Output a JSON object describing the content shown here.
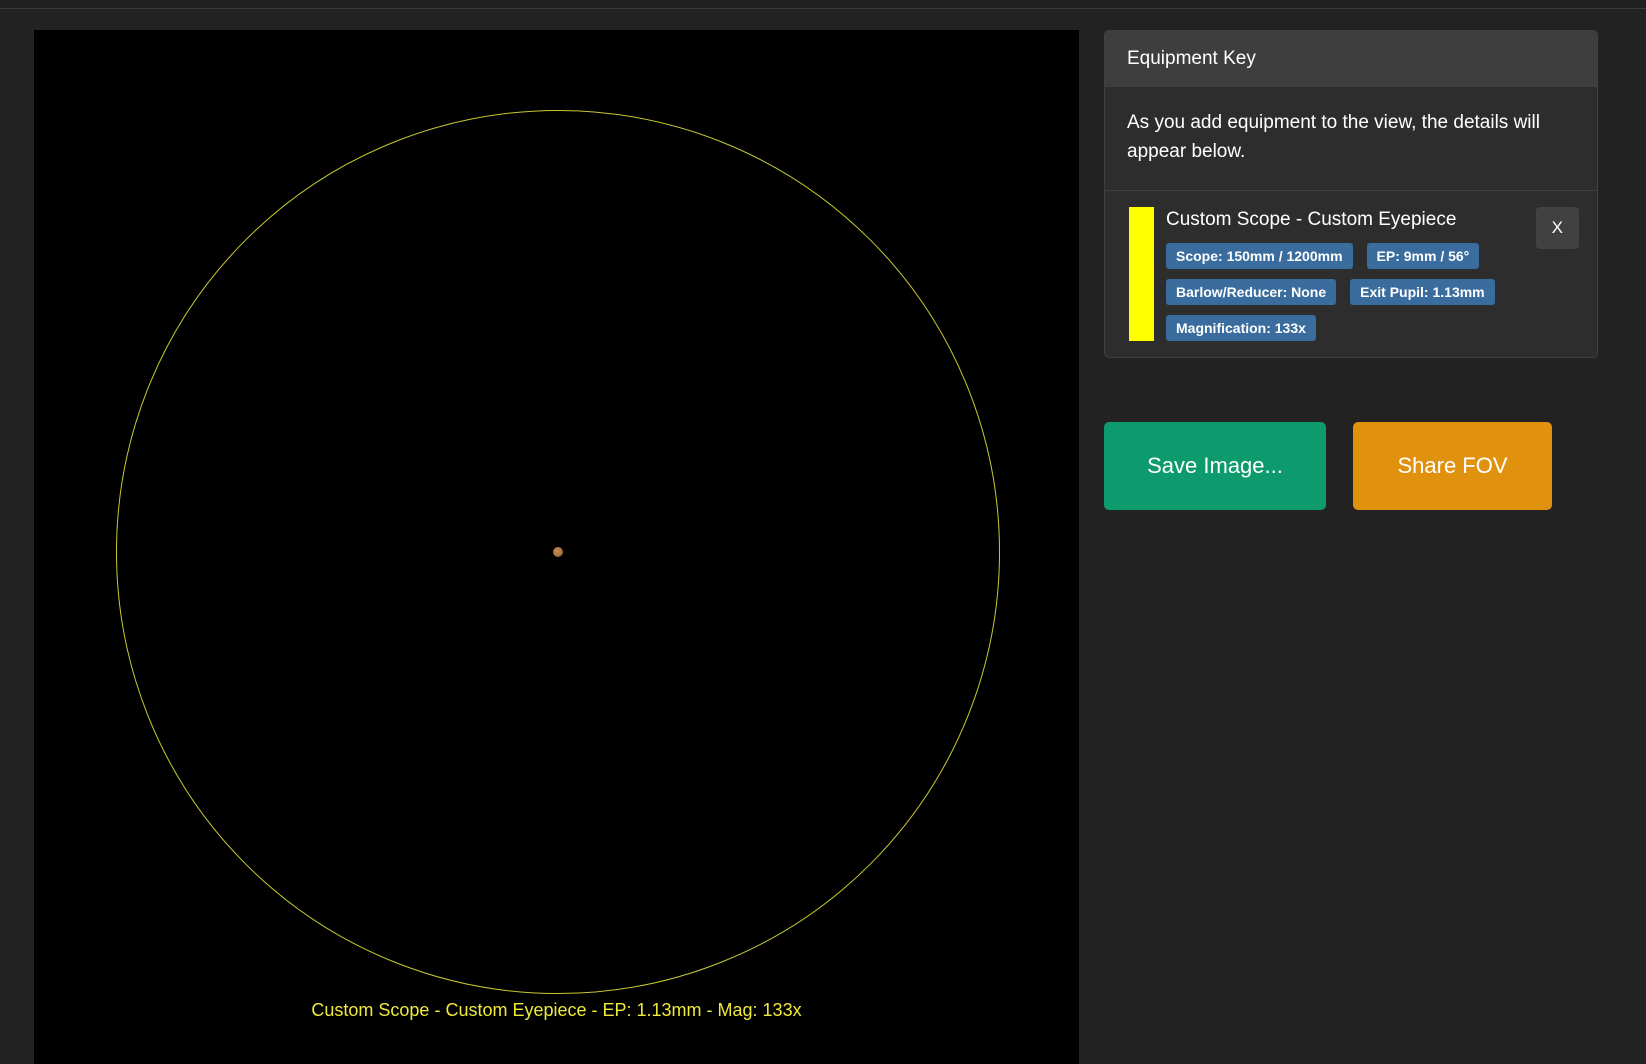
{
  "fov_view": {
    "caption": "Custom Scope - Custom Eyepiece - EP: 1.13mm - Mag: 133x"
  },
  "equipment_key": {
    "title": "Equipment Key",
    "intro": "As you add equipment to the view, the details will appear below.",
    "item": {
      "title": "Custom Scope - Custom Eyepiece",
      "badges": [
        "Scope: 150mm / 1200mm",
        "EP: 9mm / 56°",
        "Barlow/Reducer: None",
        "Exit Pupil: 1.13mm",
        "Magnification: 133x"
      ],
      "remove_label": "X"
    }
  },
  "actions": {
    "save_image_label": "Save Image...",
    "share_fov_label": "Share FOV"
  },
  "colors": {
    "circle": "#c9c92f",
    "caption": "#efe93a",
    "planet": "#a9743f",
    "swatch": "#ffff00",
    "badge_bg": "#3a6d9e",
    "save_bg": "#0d9b6e",
    "share_bg": "#e0920f"
  }
}
